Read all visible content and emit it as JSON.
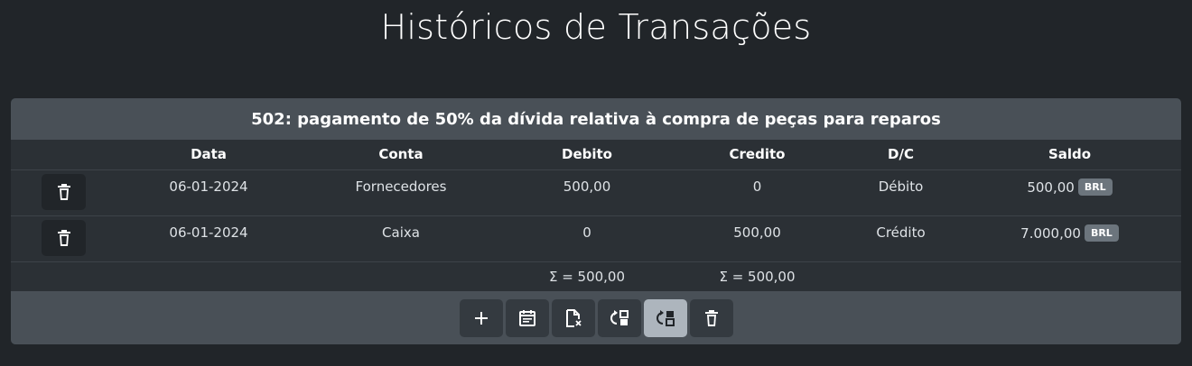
{
  "page": {
    "title": "Históricos de Transações"
  },
  "card": {
    "header": "502: pagamento de 50% da dívida relativa à compra de peças para reparos"
  },
  "table": {
    "columns": [
      "",
      "Data",
      "Conta",
      "Debito",
      "Credito",
      "D/C",
      "Saldo"
    ],
    "rows": [
      {
        "data": "06-01-2024",
        "conta": "Fornecedores",
        "debito": "500,00",
        "credito": "0",
        "dc": "Débito",
        "saldo": "500,00",
        "currency": "BRL"
      },
      {
        "data": "06-01-2024",
        "conta": "Caixa",
        "debito": "0",
        "credito": "500,00",
        "dc": "Crédito",
        "saldo": "7.000,00",
        "currency": "BRL"
      }
    ],
    "totals": {
      "debito": "Σ = 500,00",
      "credito": "Σ = 500,00"
    }
  },
  "footer": {
    "buttons": [
      {
        "icon": "plus-icon"
      },
      {
        "icon": "calendar-icon"
      },
      {
        "icon": "file-delete-icon"
      },
      {
        "icon": "swap-left-icon"
      },
      {
        "icon": "swap-right-icon",
        "active": true
      },
      {
        "icon": "trash-icon"
      }
    ]
  },
  "colors": {
    "background": "#212529",
    "card": "#2b3035",
    "header": "#495057",
    "badge": "#6c757d",
    "active_button": "#adb5bd"
  }
}
